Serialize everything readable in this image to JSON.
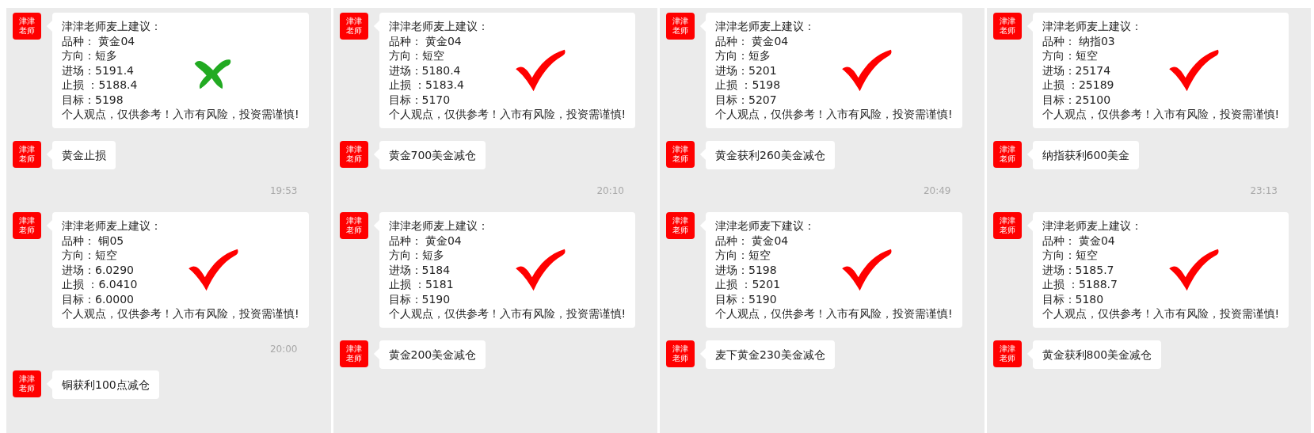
{
  "panels": [
    {
      "items": [
        {
          "kind": "message",
          "avatar": "津津老师",
          "lines": [
            "津津老师麦上建议：",
            "品种：  黄金04",
            "方向：短多",
            "进场：5191.4",
            "止损 ：5188.4",
            "目标：5198",
            "个人观点，仅供参考！入市有风险，投资需谨慎!"
          ],
          "correct": false
        },
        {
          "kind": "message",
          "avatar": "津津老师",
          "lines": [
            "黄金止损"
          ]
        },
        {
          "kind": "time",
          "text": "19:53"
        },
        {
          "kind": "message",
          "avatar": "津津老师",
          "lines": [
            "津津老师麦上建议：",
            "品种：  铜05",
            "方向：短空",
            "进场：6.0290",
            "止损 ：6.0410",
            "目标：6.0000",
            "个人观点，仅供参考！入市有风险，投资需谨慎!"
          ],
          "correct": true
        },
        {
          "kind": "time",
          "text": "20:00"
        },
        {
          "kind": "message",
          "avatar": "津津老师",
          "lines": [
            "铜获利100点减仓"
          ]
        }
      ]
    },
    {
      "items": [
        {
          "kind": "message",
          "avatar": "津津老师",
          "lines": [
            "津津老师麦上建议：",
            "品种：  黄金04",
            "方向：短空",
            "进场：5180.4",
            "止损 ：5183.4",
            "目标：5170",
            "个人观点，仅供参考！入市有风险，投资需谨慎!"
          ],
          "correct": true
        },
        {
          "kind": "message",
          "avatar": "津津老师",
          "lines": [
            "黄金700美金减仓"
          ]
        },
        {
          "kind": "time",
          "text": "20:10"
        },
        {
          "kind": "message",
          "avatar": "津津老师",
          "lines": [
            "津津老师麦上建议：",
            "品种：  黄金04",
            "方向：短多",
            "进场：5184",
            "止损 ：5181",
            "目标：5190",
            "个人观点，仅供参考！入市有风险，投资需谨慎!"
          ],
          "correct": true
        },
        {
          "kind": "message",
          "avatar": "津津老师",
          "lines": [
            "黄金200美金减仓"
          ]
        }
      ]
    },
    {
      "items": [
        {
          "kind": "message",
          "avatar": "津津老师",
          "lines": [
            "津津老师麦上建议：",
            "品种：  黄金04",
            "方向：短多",
            "进场：5201",
            "止损 ：5198",
            "目标：5207",
            "个人观点，仅供参考！入市有风险，投资需谨慎!"
          ],
          "correct": true
        },
        {
          "kind": "message",
          "avatar": "津津老师",
          "lines": [
            "黄金获利260美金减仓"
          ]
        },
        {
          "kind": "time",
          "text": "20:49"
        },
        {
          "kind": "message",
          "avatar": "津津老师",
          "lines": [
            "津津老师麦下建议：",
            "品种：  黄金04",
            "方向：短空",
            "进场：5198",
            "止损 ：5201",
            "目标：5190",
            "个人观点，仅供参考！入市有风险，投资需谨慎!"
          ],
          "correct": true
        },
        {
          "kind": "message",
          "avatar": "津津老师",
          "lines": [
            "麦下黄金230美金减仓"
          ]
        }
      ]
    },
    {
      "items": [
        {
          "kind": "message",
          "avatar": "津津老师",
          "lines": [
            "津津老师麦上建议：",
            "品种：  纳指03",
            "方向：短空",
            "进场：25174",
            "止损 ：25189",
            "目标：25100",
            "个人观点，仅供参考！入市有风险，投资需谨慎!"
          ],
          "correct": true
        },
        {
          "kind": "message",
          "avatar": "津津老师",
          "lines": [
            "纳指获利600美金"
          ]
        },
        {
          "kind": "time",
          "text": "23:13"
        },
        {
          "kind": "message",
          "avatar": "津津老师",
          "lines": [
            "津津老师麦上建议：",
            "品种：  黄金04",
            "方向：短空",
            "进场：5185.7",
            "止损 ：5188.7",
            "目标：5180",
            "个人观点，仅供参考！入市有风险，投资需谨慎!"
          ],
          "correct": true
        },
        {
          "kind": "message",
          "avatar": "津津老师",
          "lines": [
            "黄金获利800美金减仓"
          ]
        }
      ]
    }
  ]
}
